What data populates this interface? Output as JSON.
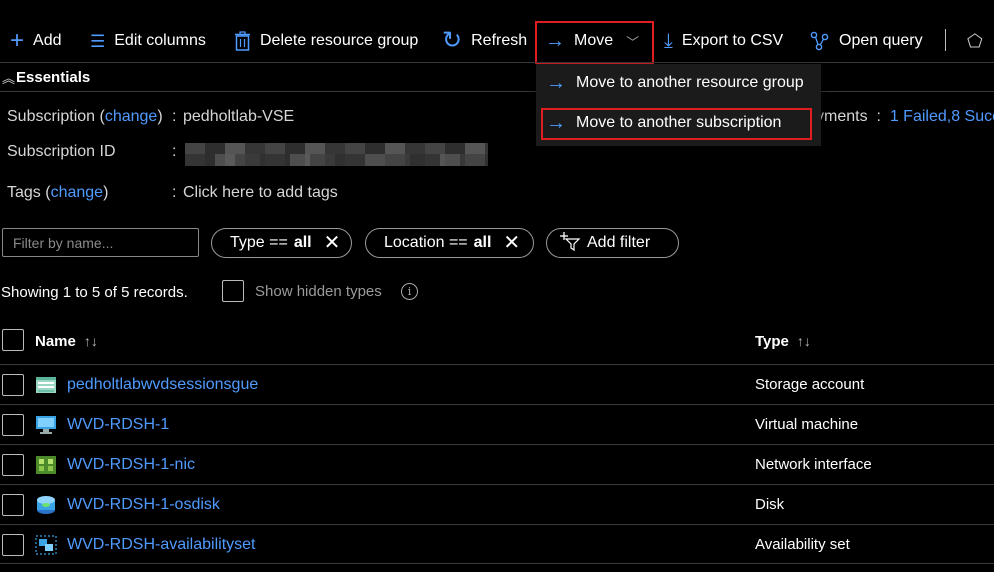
{
  "toolbar": {
    "add": "Add",
    "edit_columns": "Edit columns",
    "delete_rg": "Delete resource group",
    "refresh": "Refresh",
    "move": "Move",
    "export_csv": "Export to CSV",
    "open_query": "Open query"
  },
  "move_menu": {
    "item1": "Move to another resource group",
    "item2": "Move to another subscription"
  },
  "essentials": {
    "title": "Essentials",
    "subscription_label": "Subscription",
    "change": "change",
    "subscription_value": "pedholtlab-VSE",
    "subscription_id_label": "Subscription ID",
    "tags_label": "Tags",
    "tags_value": "Click here to add tags",
    "deployments_label": "yments",
    "deployments_value": "1 Failed,8 Succe"
  },
  "filters": {
    "placeholder": "Filter by name...",
    "type_label": "Type == ",
    "type_value": "all",
    "location_label": "Location == ",
    "location_value": "all",
    "add_filter": "Add filter"
  },
  "records_text": "Showing 1 to 5 of 5 records.",
  "show_hidden": "Show hidden types",
  "table": {
    "col_name": "Name",
    "col_type": "Type",
    "rows": [
      {
        "name": "pedholtlabwvdsessionsgue",
        "type": "Storage account",
        "icon": "storage-account-icon"
      },
      {
        "name": "WVD-RDSH-1",
        "type": "Virtual machine",
        "icon": "virtual-machine-icon"
      },
      {
        "name": "WVD-RDSH-1-nic",
        "type": "Network interface",
        "icon": "network-interface-icon"
      },
      {
        "name": "WVD-RDSH-1-osdisk",
        "type": "Disk",
        "icon": "disk-icon"
      },
      {
        "name": "WVD-RDSH-availabilityset",
        "type": "Availability set",
        "icon": "availability-set-icon"
      }
    ]
  },
  "colors": {
    "accent": "#4f9bff",
    "highlight_border": "#e01e22",
    "background": "#000000"
  }
}
